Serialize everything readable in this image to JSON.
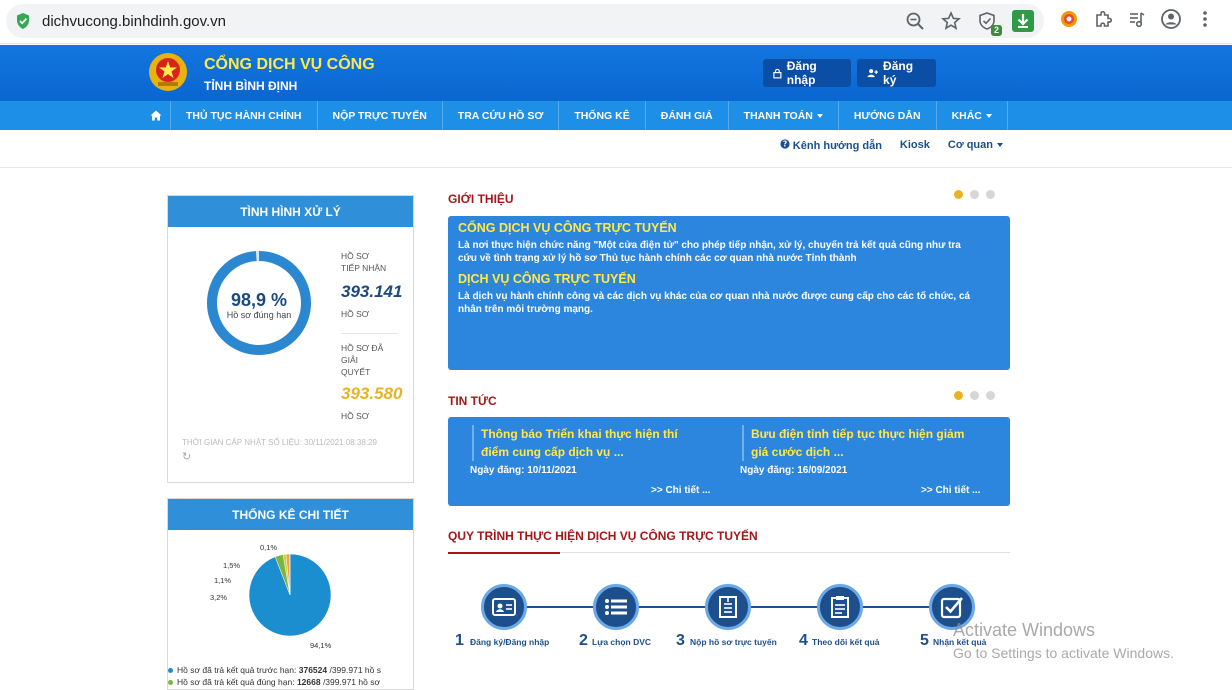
{
  "browser": {
    "url": "dichvucong.binhdinh.gov.vn",
    "ext_badge": "2"
  },
  "header": {
    "title": "CỔNG DỊCH VỤ CÔNG",
    "subtitle": "TỈNH BÌNH ĐỊNH",
    "login_label": "Đăng nhập",
    "register_label": "Đăng ký"
  },
  "nav": {
    "items": [
      {
        "label": "THỦ TỤC HÀNH CHÍNH"
      },
      {
        "label": "NỘP TRỰC TUYẾN"
      },
      {
        "label": "TRA CỨU HỒ SƠ"
      },
      {
        "label": "THỐNG KÊ"
      },
      {
        "label": "ĐÁNH GIÁ"
      },
      {
        "label": "THANH TOÁN"
      },
      {
        "label": "HƯỚNG DẪN"
      },
      {
        "label": "KHÁC"
      }
    ]
  },
  "subnav": {
    "guide": "Kênh hướng dẫn",
    "kiosk": "Kiosk",
    "agency": "Cơ quan"
  },
  "status_panel": {
    "title": "TÌNH HÌNH XỬ LÝ",
    "percent": "98,9 %",
    "percent_value": 98.9,
    "percent_label": "Hồ sơ đúng hạn",
    "received_label_1": "HỒ SƠ",
    "received_label_2": "TIẾP NHẬN",
    "received_value": "393.141",
    "received_unit": "HỒ SƠ",
    "resolved_label_1": "HỒ SƠ ĐÃ",
    "resolved_label_2": "GIẢI",
    "resolved_label_3": "QUYẾT",
    "resolved_value": "393.580",
    "resolved_unit": "HỒ SƠ",
    "update_time": "THỜI GIAN CẬP NHẬT SỐ LIỆU: 30/11/2021 08:38:29"
  },
  "detail_panel": {
    "title": "THỐNG KÊ CHI TIẾT",
    "legend": [
      {
        "text_a": "Hồ sơ đã trả kết quả trước hạn: ",
        "value": "376524",
        "text_b": " /399.971 hồ s",
        "color": "#1b8ecf"
      },
      {
        "text_a": "Hồ sơ đã trả kết quả đúng hạn: ",
        "value": "12668",
        "text_b": " /399.971 hồ sơ",
        "color": "#7cb342"
      }
    ]
  },
  "chart_data": {
    "type": "pie",
    "categories": [
      "",
      "",
      "",
      "",
      ""
    ],
    "values": [
      94.1,
      3.2,
      1.1,
      1.5,
      0.1
    ],
    "labels": [
      "94,1%",
      "3,2%",
      "1,1%",
      "1,5%",
      "0,1%"
    ],
    "colors": [
      "#1b8ecf",
      "#7cb342",
      "#c9cf2a",
      "#f2a23a",
      "#e05a3a"
    ]
  },
  "intro": {
    "title": "GIỚI THIỆU",
    "h1": "CỔNG DỊCH VỤ CÔNG TRỰC TUYẾN",
    "p1a": "Là nơi thực hiện chức năng \"Một cửa điện tử\" cho phép tiếp nhận, xử lý, chuyển trả kết quả cũng như tra",
    "p1b": "cứu về tình trạng xử lý hồ sơ Thủ tục hành chính các cơ quan nhà nước Tỉnh thành",
    "h2": "DỊCH VỤ CÔNG TRỰC TUYẾN",
    "p2a": "Là dịch vụ hành chính công và các dịch vụ khác của cơ quan nhà nước được cung cấp cho các tổ chức, cá",
    "p2b": "nhân trên môi trường mạng."
  },
  "news": {
    "title": "TIN TỨC",
    "items": [
      {
        "title_1": "Thông báo Triển khai thực hiện thí",
        "title_2": "điểm cung cấp dịch vụ ...",
        "date": "Ngày đăng: 10/11/2021",
        "more": ">> Chi tiết ..."
      },
      {
        "title_1": "Bưu điện tỉnh tiếp tục thực hiện giảm",
        "title_2": "giá cước dịch ...",
        "date": "Ngày đăng: 16/09/2021",
        "more": ">> Chi tiết ..."
      }
    ]
  },
  "process": {
    "title": "QUY TRÌNH THỰC HIỆN DỊCH VỤ CÔNG TRỰC TUYẾN",
    "steps": [
      {
        "num": "1",
        "label": "Đăng ký/Đăng nhập"
      },
      {
        "num": "2",
        "label": "Lựa chọn DVC"
      },
      {
        "num": "3",
        "label": "Nộp hồ sơ trực tuyến"
      },
      {
        "num": "4",
        "label": "Theo dõi kết quả"
      },
      {
        "num": "5",
        "label": "Nhận kết quả"
      }
    ]
  },
  "watermark": {
    "line1": "Activate Windows",
    "line2": "Go to Settings to activate Windows."
  }
}
